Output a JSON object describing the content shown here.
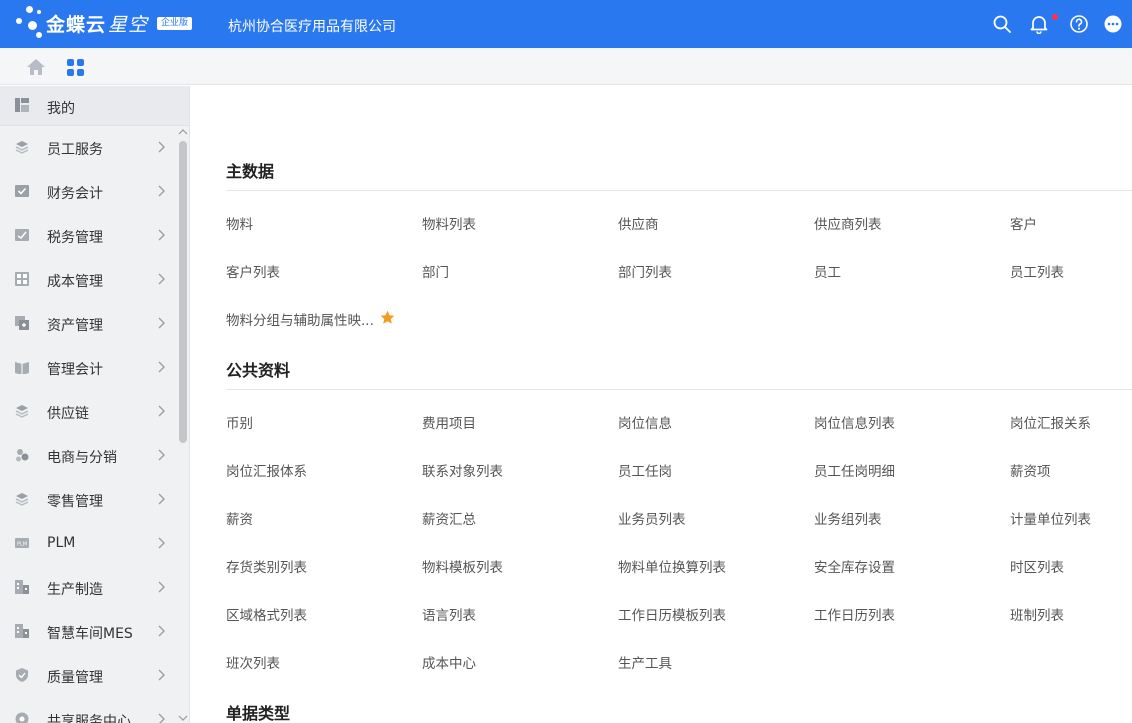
{
  "header": {
    "brand_main": "金蝶云",
    "brand_sub": "星空",
    "edition": "企业版",
    "company": "杭州协合医疗用品有限公司",
    "icons": [
      "search-icon",
      "bell-icon",
      "help-icon",
      "more-icon"
    ],
    "accent_color": "#2a78f0",
    "notification_dot_color": "#ff3344"
  },
  "toolbar": {
    "icons": [
      "home-icon",
      "apps-grid-icon"
    ]
  },
  "sidebar": {
    "mine_label": "我的",
    "items": [
      {
        "label": "员工服务",
        "icon": "layers-icon"
      },
      {
        "label": "财务会计",
        "icon": "check-box-icon"
      },
      {
        "label": "税务管理",
        "icon": "tax-icon"
      },
      {
        "label": "成本管理",
        "icon": "calculator-icon"
      },
      {
        "label": "资产管理",
        "icon": "asset-icon"
      },
      {
        "label": "管理会计",
        "icon": "book-icon"
      },
      {
        "label": "供应链",
        "icon": "layers-icon"
      },
      {
        "label": "电商与分销",
        "icon": "users-icon"
      },
      {
        "label": "零售管理",
        "icon": "layers-icon"
      },
      {
        "label": "PLM",
        "icon": "plm-icon"
      },
      {
        "label": "生产制造",
        "icon": "factory-icon"
      },
      {
        "label": "智慧车间MES",
        "icon": "factory-icon"
      },
      {
        "label": "质量管理",
        "icon": "shield-icon"
      },
      {
        "label": "共享服务中心",
        "icon": "share-icon"
      }
    ]
  },
  "sections": [
    {
      "title": "主数据",
      "links": [
        "物料",
        "物料列表",
        "供应商",
        "供应商列表",
        "客户",
        "客户列表",
        "部门",
        "部门列表",
        "员工",
        "员工列表",
        "物料分组与辅助属性映..."
      ],
      "starred_index": 10,
      "star_color": "#f59a23"
    },
    {
      "title": "公共资料",
      "links": [
        "币别",
        "费用项目",
        "岗位信息",
        "岗位信息列表",
        "岗位汇报关系",
        "岗位汇报体系",
        "联系对象列表",
        "员工任岗",
        "员工任岗明细",
        "薪资项",
        "薪资",
        "薪资汇总",
        "业务员列表",
        "业务组列表",
        "计量单位列表",
        "存货类别列表",
        "物料模板列表",
        "物料单位换算列表",
        "安全库存设置",
        "时区列表",
        "区域格式列表",
        "语言列表",
        "工作日历模板列表",
        "工作日历列表",
        "班制列表",
        "班次列表",
        "成本中心",
        "生产工具"
      ]
    },
    {
      "title": "单据类型",
      "links": []
    }
  ]
}
